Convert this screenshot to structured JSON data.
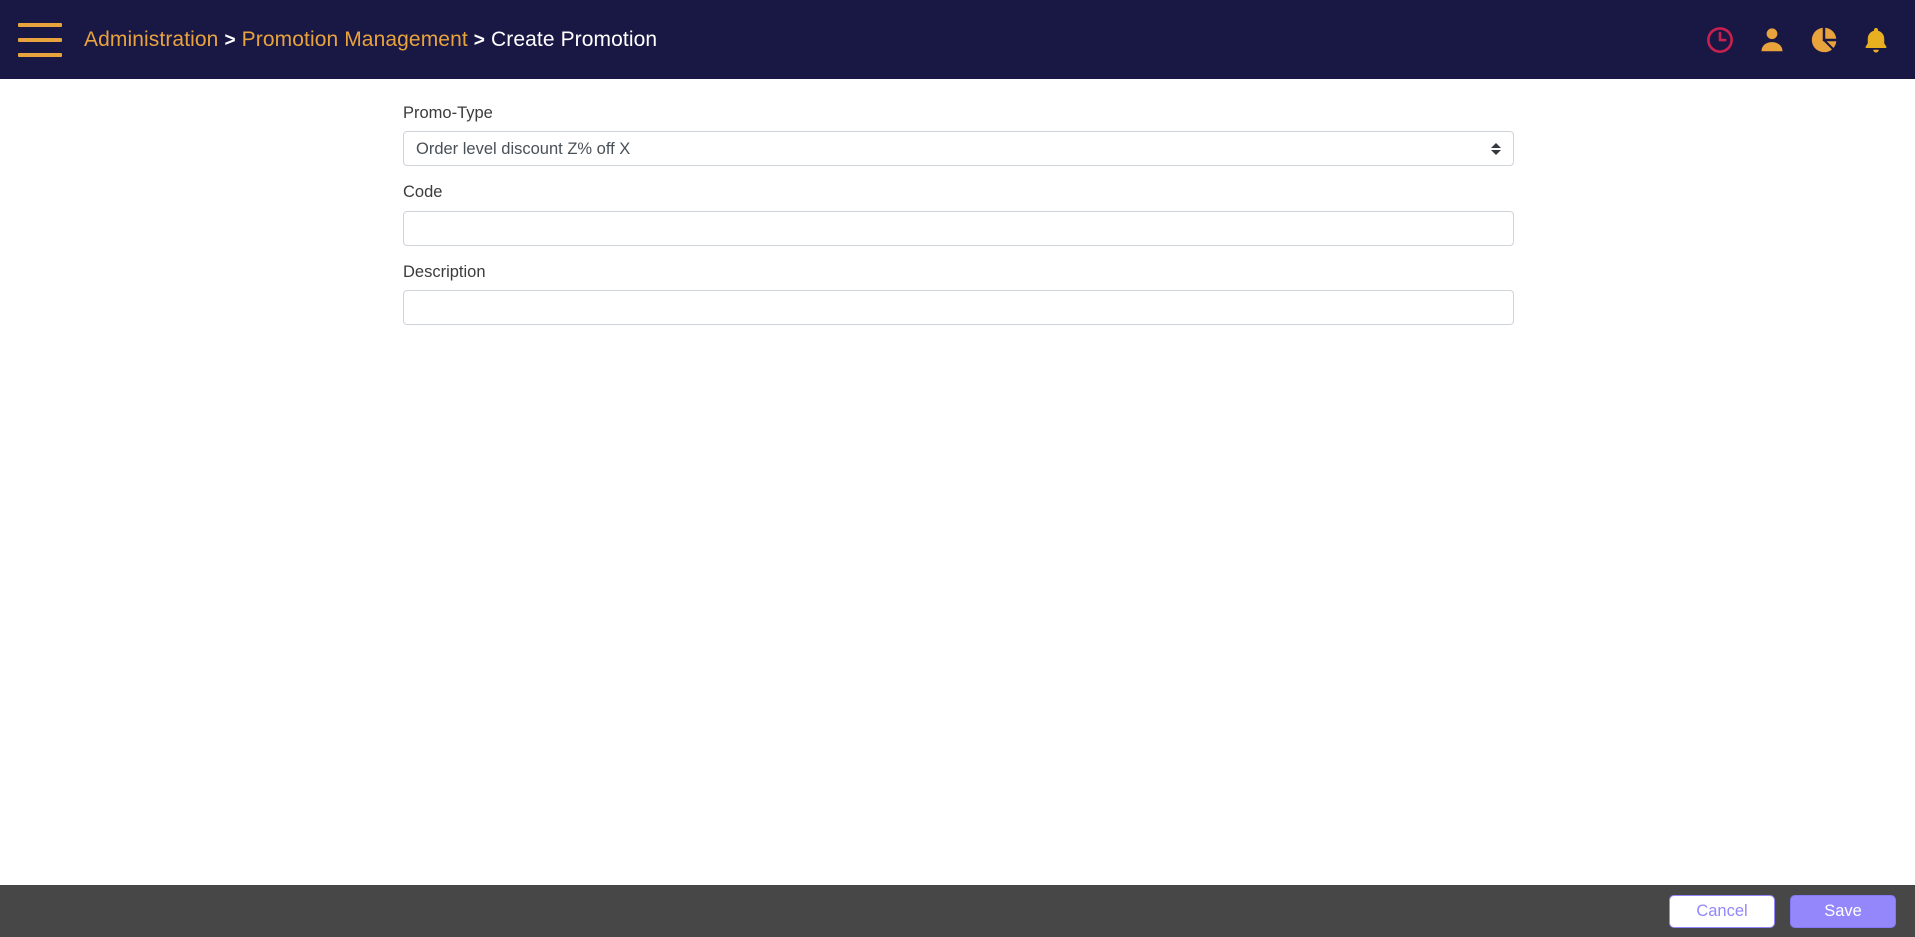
{
  "colors": {
    "header_bg": "#191744",
    "accent_orange": "#e8a33d",
    "footer_bg": "#474747",
    "primary_purple": "#9387fb",
    "clock_red": "#c8204f",
    "bell_yellow": "#e8b020",
    "page_bg": "#ffffff"
  },
  "header": {
    "menu_icon": "hamburger-menu-icon",
    "breadcrumb": {
      "separator": ">",
      "items": [
        {
          "label": "Administration",
          "current": false
        },
        {
          "label": "Promotion Management",
          "current": false
        },
        {
          "label": "Create Promotion",
          "current": true
        }
      ]
    },
    "icons": [
      {
        "name": "clock-icon",
        "title": "History"
      },
      {
        "name": "user-icon",
        "title": "Profile"
      },
      {
        "name": "pie-chart-icon",
        "title": "Reports"
      },
      {
        "name": "bell-icon",
        "title": "Notifications"
      }
    ]
  },
  "form": {
    "fields": [
      {
        "name": "promo-type",
        "label": "Promo-Type",
        "type": "select",
        "value": "Order level discount Z% off X",
        "options": [
          "Order level discount Z% off X"
        ]
      },
      {
        "name": "code",
        "label": "Code",
        "type": "text",
        "value": "",
        "placeholder": ""
      },
      {
        "name": "description",
        "label": "Description",
        "type": "text",
        "value": "",
        "placeholder": ""
      }
    ]
  },
  "footer": {
    "cancel_label": "Cancel",
    "save_label": "Save"
  }
}
